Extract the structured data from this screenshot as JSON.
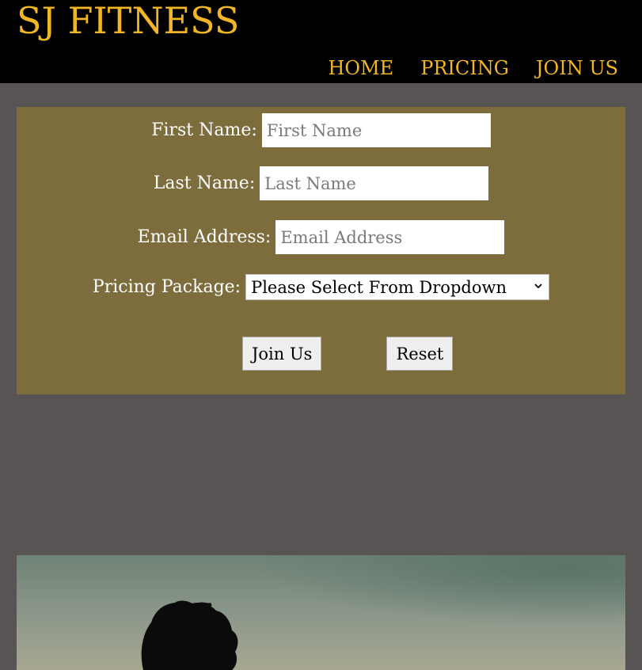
{
  "header": {
    "brand": "SJ FITNESS",
    "nav": [
      "HOME",
      "PRICING",
      "JOIN US"
    ]
  },
  "form": {
    "first_name": {
      "label": "First Name:",
      "placeholder": "First Name"
    },
    "last_name": {
      "label": "Last Name:",
      "placeholder": "Last Name"
    },
    "email": {
      "label": "Email Address:",
      "placeholder": "Email Address"
    },
    "package": {
      "label": "Pricing Package:",
      "selected": "Please Select From Dropdown"
    },
    "submit_label": "Join Us",
    "reset_label": "Reset"
  },
  "colors": {
    "accent": "#f2b624",
    "header_bg": "#000000",
    "page_bg": "#575453",
    "form_bg": "#7d6d3d"
  }
}
